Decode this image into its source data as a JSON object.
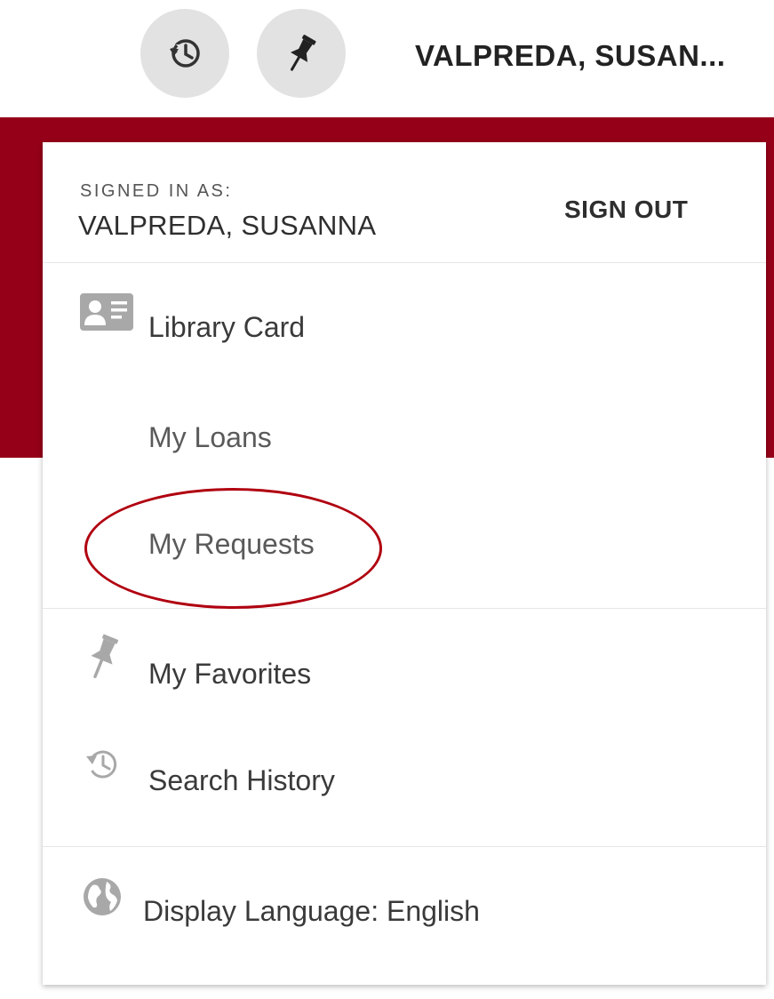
{
  "topbar": {
    "history_button": {
      "icon": "history-icon"
    },
    "pin_button": {
      "icon": "pin-icon"
    },
    "user_name": "VALPREDA, SUSAN..."
  },
  "account_menu": {
    "signed_in_label": "SIGNED IN AS:",
    "signed_in_name": "VALPREDA, SUSANNA",
    "sign_out_label": "SIGN OUT",
    "items": [
      {
        "label": "Library Card",
        "icon": "library-card-icon"
      },
      {
        "label": "My Loans"
      },
      {
        "label": "My Requests",
        "highlighted": true
      },
      {
        "label": "My Favorites",
        "icon": "pin-icon"
      },
      {
        "label": "Search History",
        "icon": "history-icon"
      },
      {
        "label": "Display Language: English",
        "icon": "globe-icon"
      }
    ]
  },
  "colors": {
    "brand_red": "#950018",
    "annotation_red": "#b00010",
    "icon_gray": "#a8a8a8"
  }
}
